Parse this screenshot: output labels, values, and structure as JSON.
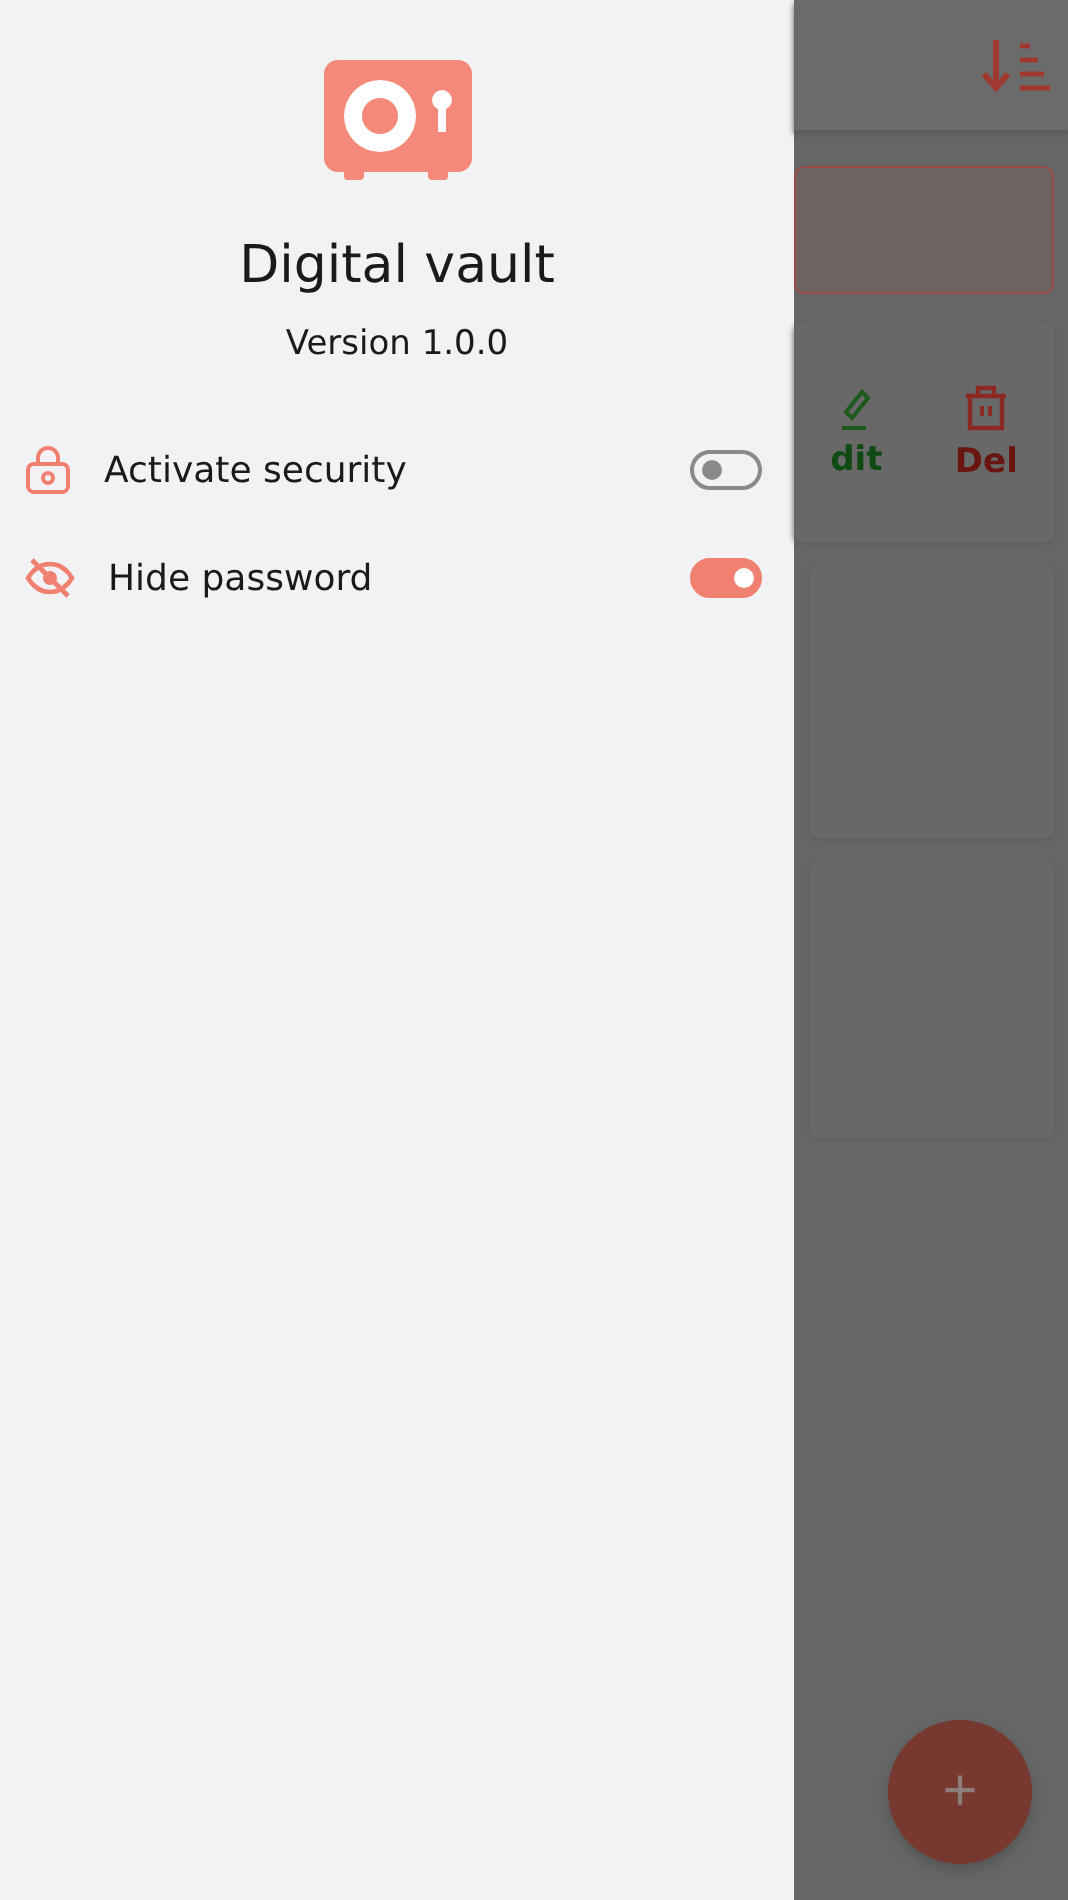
{
  "drawer": {
    "title": "Digital vault",
    "version": "Version 1.0.0",
    "settings": [
      {
        "kind": "lock",
        "label": "Activate security",
        "on": false
      },
      {
        "kind": "eye-off",
        "label": "Hide password",
        "on": true
      }
    ]
  },
  "background": {
    "actions": [
      {
        "kind": "edit",
        "label": "dit"
      },
      {
        "kind": "delete",
        "label": "Del"
      }
    ],
    "fab": "+"
  }
}
